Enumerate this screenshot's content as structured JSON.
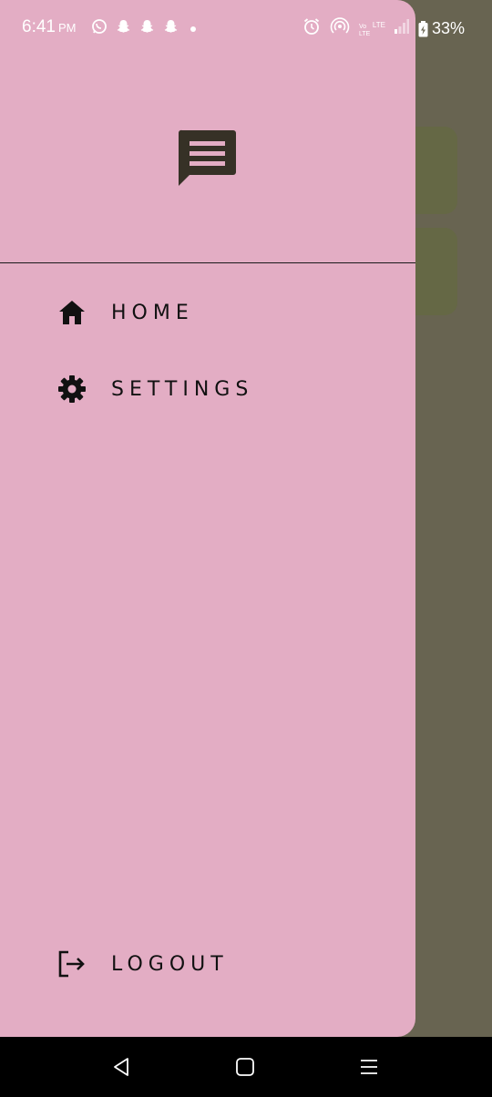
{
  "status_bar": {
    "time": "6:41",
    "ampm": "PM",
    "battery": "33%",
    "left_icons": [
      "whatsapp-icon",
      "snapchat-icon",
      "snapchat-icon",
      "snapchat-icon",
      "dot-icon"
    ],
    "right_icons": [
      "alarm-icon",
      "hotspot-icon",
      "volte-lte-icon",
      "signal-icon",
      "battery-charging-icon"
    ],
    "network_label": "LTE"
  },
  "drawer": {
    "header_icon": "chat-message-icon",
    "items": [
      {
        "label": "HOME",
        "icon": "home-icon"
      },
      {
        "label": "SETTINGS",
        "icon": "gear-icon"
      }
    ],
    "logout": {
      "label": "LOGOUT",
      "icon": "logout-icon"
    }
  },
  "nav_bar": {
    "buttons": [
      "back-icon",
      "home-button-icon",
      "recents-icon"
    ]
  },
  "colors": {
    "drawer_bg": "#e3adc4",
    "scrim": "#686451",
    "background_card": "#656845",
    "text": "#111111",
    "logo": "#363126"
  }
}
